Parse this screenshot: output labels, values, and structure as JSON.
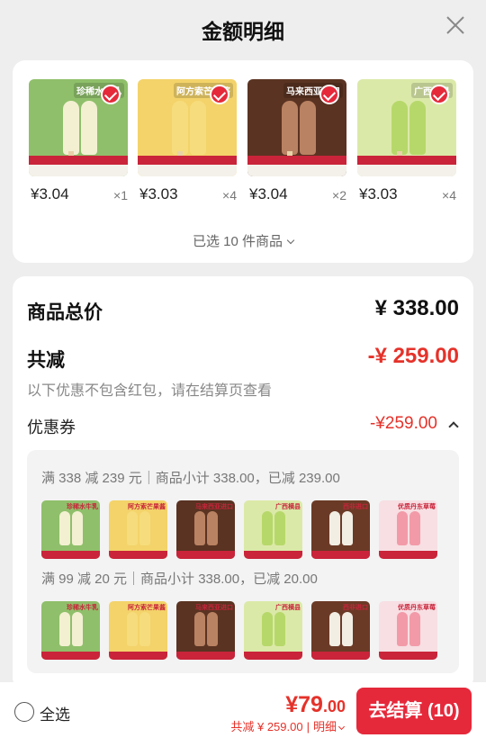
{
  "header": {
    "title": "金额明细"
  },
  "products": [
    {
      "price": "¥3.04",
      "qty": "×1",
      "caption": "珍稀水牛乳",
      "bg": "#8fbf6a",
      "pop": "#f3f0d2"
    },
    {
      "price": "¥3.03",
      "qty": "×4",
      "caption": "阿方索芒果酱",
      "bg": "#f3d36a",
      "pop": "#f6dc7c"
    },
    {
      "price": "¥3.04",
      "qty": "×2",
      "caption": "马来西亚进口",
      "bg": "#5a3322",
      "pop": "#b98262"
    },
    {
      "price": "¥3.03",
      "qty": "×4",
      "caption": "广西横县",
      "bg": "#dbe9a8",
      "pop": "#b6d86a"
    }
  ],
  "selected_text": "已选 10 件商品",
  "summary": {
    "total_label": "商品总价",
    "total_value": "¥ 338.00",
    "discount_label": "共减",
    "discount_value": "-¥ 259.00",
    "note": "以下优惠不包含红包，请在结算页查看",
    "coupon_label": "优惠券",
    "coupon_value": "-¥259.00"
  },
  "coupons": [
    {
      "line": "满 338 减 239 元｜商品小计 338.00，已减 239.00",
      "items": [
        {
          "cap": "珍稀水牛乳",
          "bg": "#8fbf6a",
          "pop": "#f3f0d2"
        },
        {
          "cap": "阿方索芒果酱",
          "bg": "#f3d36a",
          "pop": "#f6dc7c"
        },
        {
          "cap": "马来西亚进口",
          "bg": "#5a3322",
          "pop": "#b98262"
        },
        {
          "cap": "广西横县",
          "bg": "#dbe9a8",
          "pop": "#b6d86a"
        },
        {
          "cap": "西非进口",
          "bg": "#6b3a26",
          "pop": "#f2eee4"
        },
        {
          "cap": "优质丹东草莓",
          "bg": "#f7dfe3",
          "pop": "#f29aa8"
        }
      ]
    },
    {
      "line": "满 99 减 20 元｜商品小计 338.00，已减 20.00",
      "items": [
        {
          "cap": "珍稀水牛乳",
          "bg": "#8fbf6a",
          "pop": "#f3f0d2"
        },
        {
          "cap": "阿方索芒果酱",
          "bg": "#f3d36a",
          "pop": "#f6dc7c"
        },
        {
          "cap": "马来西亚进口",
          "bg": "#5a3322",
          "pop": "#b98262"
        },
        {
          "cap": "广西横县",
          "bg": "#dbe9a8",
          "pop": "#b6d86a"
        },
        {
          "cap": "西非进口",
          "bg": "#6b3a26",
          "pop": "#f2eee4"
        },
        {
          "cap": "优质丹东草莓",
          "bg": "#f7dfe3",
          "pop": "#f29aa8"
        }
      ]
    }
  ],
  "footer": {
    "select_all": "全选",
    "pay_int": "¥79",
    "pay_dec": ".00",
    "sub_discount": "共减 ¥ 259.00",
    "sub_detail": "明细",
    "checkout": "去结算 (10)"
  }
}
